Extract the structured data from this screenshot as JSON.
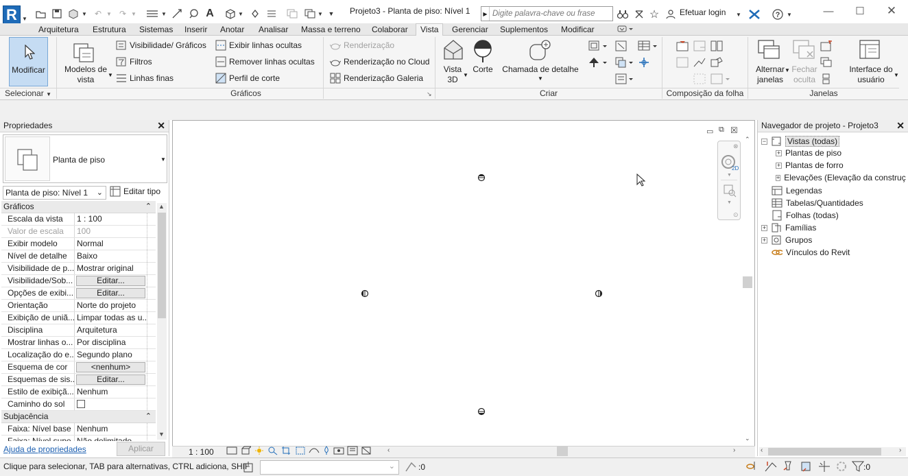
{
  "app": {
    "logo_letter": "R",
    "title": "Projeto3 - Planta de piso: Nível 1"
  },
  "search": {
    "placeholder": "Digite palavra-chave ou frase"
  },
  "account": {
    "login_label": "Efetuar login"
  },
  "tabs": [
    {
      "label": "Arquitetura"
    },
    {
      "label": "Estrutura"
    },
    {
      "label": "Sistemas"
    },
    {
      "label": "Inserir"
    },
    {
      "label": "Anotar"
    },
    {
      "label": "Analisar"
    },
    {
      "label": "Massa e terreno"
    },
    {
      "label": "Colaborar"
    },
    {
      "label": "Vista",
      "active": true
    },
    {
      "label": "Gerenciar"
    },
    {
      "label": "Suplementos"
    },
    {
      "label": "Modificar"
    }
  ],
  "ribbon": {
    "selecionar": {
      "modify_label": "Modificar",
      "panel_label": "Selecionar"
    },
    "graficos": {
      "panel_label": "Gráficos",
      "view_templates_line1": "Modelos de",
      "view_templates_line2": "vista",
      "visibility": "Visibilidade/ Gráficos",
      "filters": "Filtros",
      "thin_lines": "Linhas finas",
      "show_hidden": "Exibir linhas ocultas",
      "remove_hidden": "Remover linhas ocultas",
      "cut_profile": "Perfil de corte",
      "render": "Renderização",
      "render_cloud": "Renderização  no Cloud",
      "render_gallery": "Renderização  Galeria"
    },
    "criar": {
      "panel_label": "Criar",
      "view3d_line1": "Vista",
      "view3d_line2": "3D",
      "section": "Corte",
      "callout": "Chamada de detalhe"
    },
    "sheet": {
      "panel_label": "Composição da folha"
    },
    "janelas": {
      "panel_label": "Janelas",
      "switch_line1": "Alternar",
      "switch_line2": "janelas",
      "close_line1": "Fechar",
      "close_line2": "oculta",
      "ui_line1": "Interface do",
      "ui_line2": "usuário"
    }
  },
  "properties": {
    "title": "Propriedades",
    "type_name": "Planta de piso",
    "instance_selector": "Planta de piso: Nível 1",
    "edit_type": "Editar tipo",
    "sections": {
      "graphics": "Gráficos",
      "underlay": "Subjacência"
    },
    "rows": [
      {
        "k": "Escala da vista",
        "v": "1 : 100"
      },
      {
        "k": "Valor de escala",
        "v": "100",
        "disabled": true
      },
      {
        "k": "Exibir modelo",
        "v": "Normal"
      },
      {
        "k": "Nível de detalhe",
        "v": "Baixo"
      },
      {
        "k": "Visibilidade de p...",
        "v": "Mostrar original"
      },
      {
        "k": "Visibilidade/Sob...",
        "v": "Editar...",
        "button": true
      },
      {
        "k": "Opções de exibi...",
        "v": "Editar...",
        "button": true
      },
      {
        "k": "Orientação",
        "v": "Norte do projeto"
      },
      {
        "k": "Exibição de uniã...",
        "v": "Limpar todas as u..."
      },
      {
        "k": "Disciplina",
        "v": "Arquitetura"
      },
      {
        "k": "Mostrar linhas o...",
        "v": "Por disciplina"
      },
      {
        "k": "Localização do e...",
        "v": "Segundo plano"
      },
      {
        "k": "Esquema de cor",
        "v": "<nenhum>",
        "button": true
      },
      {
        "k": "Esquemas de sis...",
        "v": "Editar...",
        "button": true
      },
      {
        "k": "Estilo de exibiçã...",
        "v": "Nenhum"
      },
      {
        "k": "Caminho do sol",
        "v": "",
        "checkbox": true
      }
    ],
    "underlay_rows": [
      {
        "k": "Faixa: Nível base",
        "v": "Nenhum"
      },
      {
        "k": "Faixa: Nível supe...",
        "v": "Não delimitado"
      }
    ],
    "help_link": "Ajuda de propriedades",
    "apply": "Aplicar"
  },
  "viewbar": {
    "scale": "1 : 100"
  },
  "browser": {
    "title": "Navegador de projeto - Projeto3",
    "nodes": [
      {
        "label": "Vistas (todas)",
        "selected": true
      },
      {
        "label": "Plantas de piso"
      },
      {
        "label": "Plantas de forro"
      },
      {
        "label": "Elevações (Elevação da construção)"
      },
      {
        "label": "Legendas"
      },
      {
        "label": "Tabelas/Quantidades"
      },
      {
        "label": "Folhas (todas)"
      },
      {
        "label": "Famílias"
      },
      {
        "label": "Grupos"
      },
      {
        "label": "Vínculos do Revit"
      }
    ]
  },
  "status": {
    "hint": "Clique para selecionar, TAB para alternativas, CTRL adiciona, SHIF",
    "worksets_count": ":0",
    "filter_count": ":0"
  },
  "colors": {
    "brand": "#1e6bb8",
    "active_button": "#c5dcf3",
    "link": "#1c5fb0"
  }
}
